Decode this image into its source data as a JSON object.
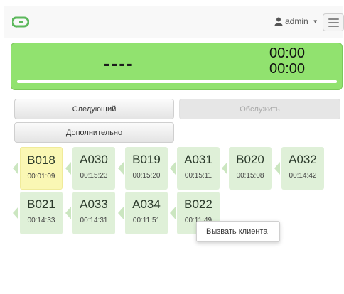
{
  "navbar": {
    "user_name": "admin",
    "logo_color": "#5cb85c"
  },
  "display": {
    "current_code": "----",
    "time_1": "00:00",
    "time_2": "00:00",
    "progress_fraction": 1.0,
    "background_color": "#91e26f"
  },
  "actions": {
    "next_label": "Следующий",
    "serve_label": "Обслужить",
    "serve_enabled": false,
    "extra_label": "Дополнительно"
  },
  "tickets": [
    {
      "code": "B018",
      "time": "00:01:09",
      "active": true
    },
    {
      "code": "A030",
      "time": "00:15:23",
      "active": false
    },
    {
      "code": "B019",
      "time": "00:15:20",
      "active": false
    },
    {
      "code": "A031",
      "time": "00:15:11",
      "active": false
    },
    {
      "code": "B020",
      "time": "00:15:08",
      "active": false
    },
    {
      "code": "A032",
      "time": "00:14:42",
      "active": false
    },
    {
      "code": "B021",
      "time": "00:14:33",
      "active": false
    },
    {
      "code": "A033",
      "time": "00:14:31",
      "active": false
    },
    {
      "code": "A034",
      "time": "00:11:51",
      "active": false
    },
    {
      "code": "B022",
      "time": "00:11:49",
      "active": false
    }
  ],
  "context_menu": {
    "items": [
      "Вызвать клиента"
    ]
  },
  "colors": {
    "ticket_bg": "#dff0d8",
    "ticket_active_bg": "#faf7b4"
  }
}
